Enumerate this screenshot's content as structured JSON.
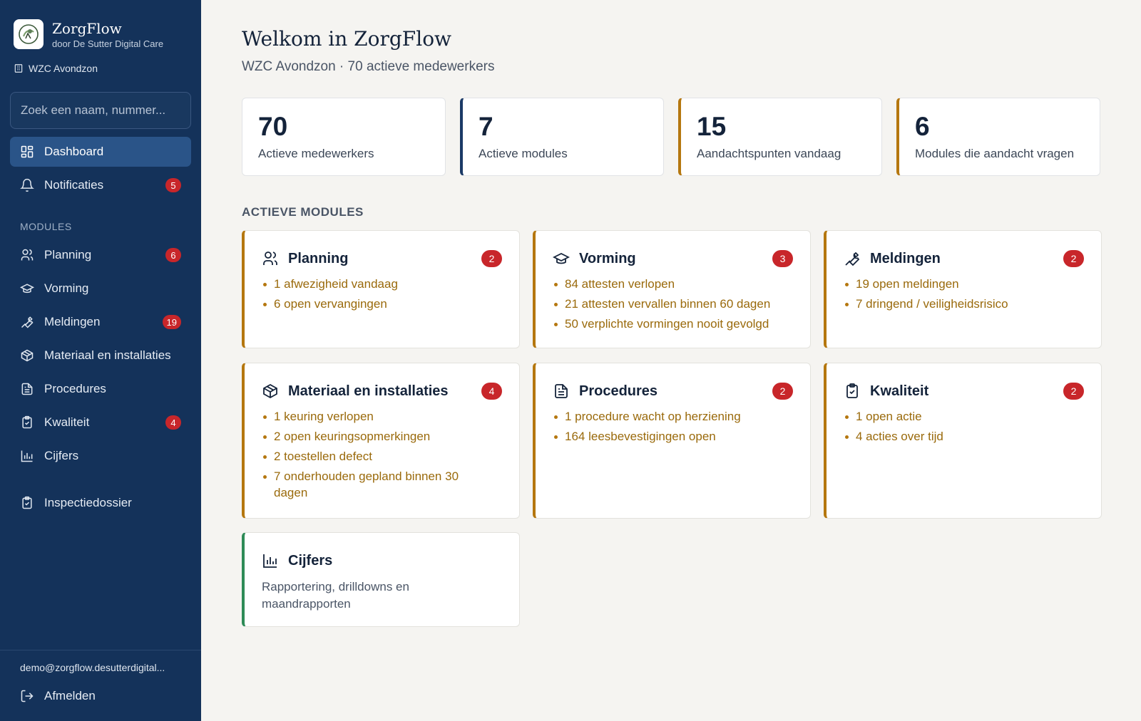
{
  "brand": {
    "name": "ZorgFlow",
    "subtitle": "door De Sutter Digital Care",
    "organization": "WZC Avondzon"
  },
  "search": {
    "placeholder": "Zoek een naam, nummer..."
  },
  "nav": {
    "dashboard": {
      "label": "Dashboard"
    },
    "notificaties": {
      "label": "Notificaties",
      "badge": "5"
    },
    "section_label": "MODULES",
    "planning": {
      "label": "Planning",
      "badge": "6"
    },
    "vorming": {
      "label": "Vorming"
    },
    "meldingen": {
      "label": "Meldingen",
      "badge": "19"
    },
    "materiaal": {
      "label": "Materiaal en installaties"
    },
    "procedures": {
      "label": "Procedures"
    },
    "kwaliteit": {
      "label": "Kwaliteit",
      "badge": "4"
    },
    "cijfers": {
      "label": "Cijfers"
    },
    "inspectiedossier": {
      "label": "Inspectiedossier"
    }
  },
  "footer": {
    "email": "demo@zorgflow.desutterdigital...",
    "logout_label": "Afmelden"
  },
  "header": {
    "title": "Welkom in ZorgFlow",
    "subtitle": "WZC Avondzon · 70 actieve medewerkers"
  },
  "stats": [
    {
      "value": "70",
      "label": "Actieve medewerkers"
    },
    {
      "value": "7",
      "label": "Actieve modules"
    },
    {
      "value": "15",
      "label": "Aandachtspunten vandaag"
    },
    {
      "value": "6",
      "label": "Modules die aandacht vragen"
    }
  ],
  "modules_heading": "ACTIEVE MODULES",
  "modules": {
    "planning": {
      "title": "Planning",
      "badge": "2",
      "items": [
        "1 afwezigheid vandaag",
        "6 open vervangingen"
      ]
    },
    "vorming": {
      "title": "Vorming",
      "badge": "3",
      "items": [
        "84 attesten verlopen",
        "21 attesten vervallen binnen 60 dagen",
        "50 verplichte vormingen nooit gevolgd"
      ]
    },
    "meldingen": {
      "title": "Meldingen",
      "badge": "2",
      "items": [
        "19 open meldingen",
        "7 dringend / veiligheidsrisico"
      ]
    },
    "materiaal": {
      "title": "Materiaal en installaties",
      "badge": "4",
      "items": [
        "1 keuring verlopen",
        "2 open keuringsopmerkingen",
        "2 toestellen defect",
        "7 onderhouden gepland binnen 30 dagen"
      ]
    },
    "procedures": {
      "title": "Procedures",
      "badge": "2",
      "items": [
        "1 procedure wacht op herziening",
        "164 leesbevestigingen open"
      ]
    },
    "kwaliteit": {
      "title": "Kwaliteit",
      "badge": "2",
      "items": [
        "1 open actie",
        "4 acties over tijd"
      ]
    },
    "cijfers": {
      "title": "Cijfers",
      "description": "Rapportering, drilldowns en maandrapporten"
    }
  },
  "colors": {
    "sidebar": "#14325a",
    "active_nav": "#2a5488",
    "accent_gold": "#b5770f",
    "accent_navy": "#1b3a66",
    "accent_green": "#2e8b57",
    "badge_red": "#c8262a",
    "page_bg": "#f5f4f1"
  }
}
